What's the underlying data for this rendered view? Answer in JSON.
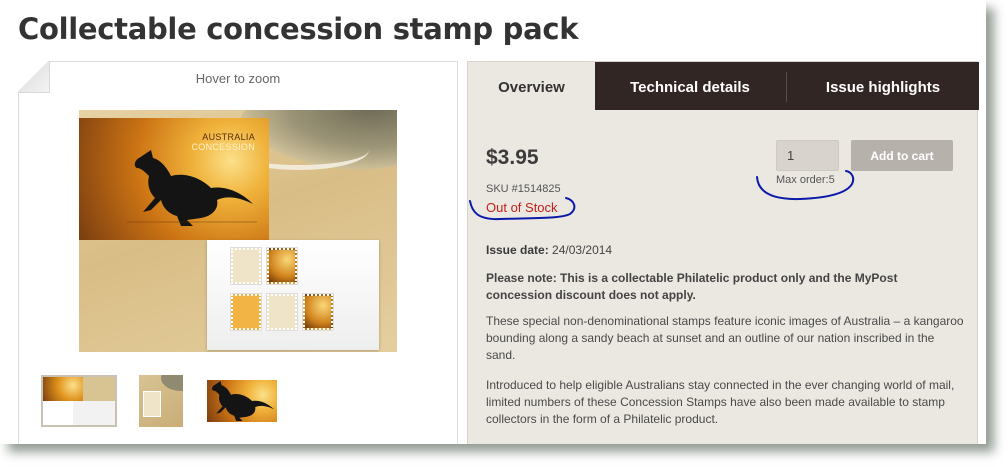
{
  "page": {
    "title": "Collectable concession stamp pack"
  },
  "gallery": {
    "hover_hint": "Hover to zoom",
    "postcard_country": "AUSTRALIA",
    "postcard_label": "CONCESSION",
    "thumbnail_count": 3
  },
  "tabs": [
    {
      "label": "Overview",
      "active": true
    },
    {
      "label": "Technical details",
      "active": false
    },
    {
      "label": "Issue highlights",
      "active": false
    }
  ],
  "product": {
    "price": "$3.95",
    "sku": "SKU #1514825",
    "stock_status": "Out of Stock",
    "quantity_value": "1",
    "add_to_cart_label": "Add to cart",
    "max_order": "Max order:5",
    "issue_date_label": "Issue date:",
    "issue_date_value": "24/03/2014",
    "note": "Please note: This is a collectable Philatelic product only and the MyPost concession discount does not apply.",
    "paragraph_1": "These special non-denominational stamps feature iconic images of Australia – a kangaroo bounding along a sandy beach at sunset and an outline of our nation inscribed in the sand.",
    "paragraph_2": "Introduced to help eligible Australians stay connected in the ever changing world of mail, limited numbers of these Concession Stamps have also been made available to stamp collectors in the form of a Philatelic product."
  },
  "colors": {
    "tab_bar": "#312624",
    "panel_bg": "#ebe7e1",
    "stock_red": "#c0201b",
    "annotation_blue": "#0a1aa8",
    "button_disabled": "#b7b1ab"
  }
}
